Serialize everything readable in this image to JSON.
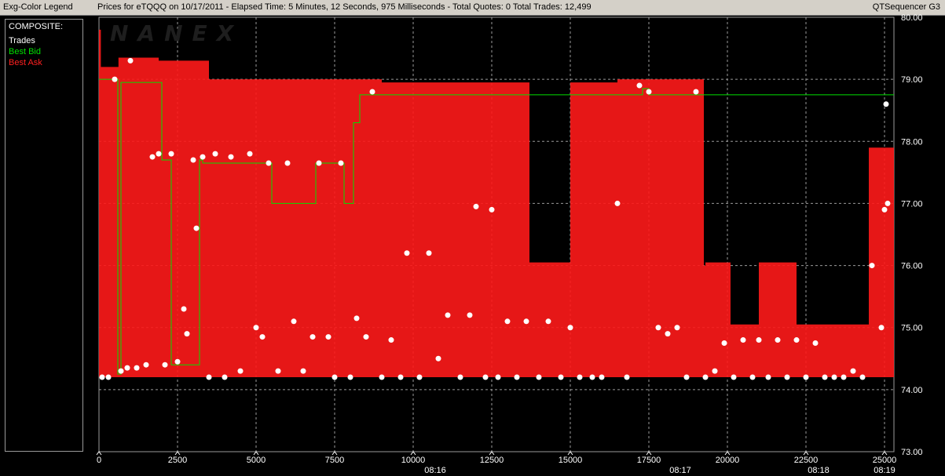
{
  "header": {
    "legend_title": "Exg-Color Legend",
    "chart_title": "Prices for  eTQQQ  on  10/17/2011  -  Elapsed Time: 5 Minutes, 12 Seconds, 975 Milliseconds  -  Total Quotes: 0  Total Trades: 12,499",
    "app_name": "QTSequencer G3"
  },
  "legend": {
    "group": "COMPOSITE:",
    "items": [
      {
        "label": "Trades",
        "color": "#ffffff"
      },
      {
        "label": "Best Bid",
        "color": "#00e000"
      },
      {
        "label": "Best Ask",
        "color": "#ff1a1a"
      }
    ]
  },
  "watermark": "NANEX",
  "chart_data": {
    "type": "scatter",
    "title": "Prices for  eTQQQ  on  10/17/2011",
    "xlim": [
      0,
      25300
    ],
    "ylim": [
      73.0,
      80.0
    ],
    "x_ticks": [
      0,
      2500,
      5000,
      7500,
      10000,
      12500,
      15000,
      17500,
      20000,
      22500,
      25000
    ],
    "y_ticks": [
      73.0,
      74.0,
      75.0,
      76.0,
      77.0,
      78.0,
      79.0,
      80.0
    ],
    "time_ticks": [
      {
        "x": 10700,
        "label": "08:16"
      },
      {
        "x": 18500,
        "label": "08:17"
      },
      {
        "x": 22900,
        "label": "08:18"
      },
      {
        "x": 25000,
        "label": "08:19"
      }
    ],
    "grid": true,
    "colors": {
      "trades": "#ffffff",
      "bid": "#00e000",
      "ask": "#ff1a1a",
      "grid": "#9a9a9a"
    },
    "series": [
      {
        "name": "Best Ask",
        "type": "step",
        "points": [
          [
            0,
            79.8
          ],
          [
            60,
            79.2
          ],
          [
            620,
            79.35
          ],
          [
            1900,
            79.3
          ],
          [
            3500,
            79.0
          ],
          [
            9000,
            78.95
          ],
          [
            13600,
            78.95
          ],
          [
            13700,
            76.05
          ],
          [
            15000,
            78.95
          ],
          [
            16500,
            79.0
          ],
          [
            19200,
            79.0
          ],
          [
            19250,
            76.0
          ],
          [
            19300,
            76.05
          ],
          [
            20100,
            75.05
          ],
          [
            21000,
            76.05
          ],
          [
            22000,
            76.05
          ],
          [
            22200,
            75.05
          ],
          [
            23000,
            75.05
          ],
          [
            24500,
            77.9
          ],
          [
            25000,
            77.9
          ],
          [
            25300,
            78.8
          ]
        ]
      },
      {
        "name": "Best Bid",
        "type": "step",
        "points": [
          [
            0,
            79.0
          ],
          [
            600,
            74.25
          ],
          [
            700,
            78.95
          ],
          [
            2000,
            77.7
          ],
          [
            2300,
            74.4
          ],
          [
            3200,
            77.7
          ],
          [
            3300,
            77.65
          ],
          [
            5100,
            77.65
          ],
          [
            5500,
            77.0
          ],
          [
            6600,
            77.0
          ],
          [
            6900,
            77.65
          ],
          [
            7800,
            77.0
          ],
          [
            8100,
            78.3
          ],
          [
            8300,
            78.75
          ],
          [
            17300,
            78.85
          ],
          [
            17500,
            78.75
          ],
          [
            25300,
            78.75
          ]
        ]
      },
      {
        "name": "Trades",
        "type": "scatter",
        "points": [
          [
            100,
            74.2
          ],
          [
            300,
            74.2
          ],
          [
            500,
            79.0
          ],
          [
            700,
            74.3
          ],
          [
            900,
            74.35
          ],
          [
            1000,
            79.3
          ],
          [
            1200,
            74.35
          ],
          [
            1500,
            74.4
          ],
          [
            1700,
            77.75
          ],
          [
            1900,
            77.8
          ],
          [
            2100,
            74.4
          ],
          [
            2300,
            77.8
          ],
          [
            2500,
            74.45
          ],
          [
            2700,
            75.3
          ],
          [
            2800,
            74.9
          ],
          [
            3000,
            77.7
          ],
          [
            3100,
            76.6
          ],
          [
            3300,
            77.75
          ],
          [
            3500,
            74.2
          ],
          [
            3700,
            77.8
          ],
          [
            4000,
            74.2
          ],
          [
            4200,
            77.75
          ],
          [
            4500,
            74.3
          ],
          [
            4800,
            77.8
          ],
          [
            5000,
            75.0
          ],
          [
            5200,
            74.85
          ],
          [
            5400,
            77.65
          ],
          [
            5700,
            74.3
          ],
          [
            6000,
            77.65
          ],
          [
            6200,
            75.1
          ],
          [
            6500,
            74.3
          ],
          [
            6800,
            74.85
          ],
          [
            7000,
            77.65
          ],
          [
            7300,
            74.85
          ],
          [
            7500,
            74.2
          ],
          [
            7700,
            77.65
          ],
          [
            8000,
            74.2
          ],
          [
            8200,
            75.15
          ],
          [
            8500,
            74.85
          ],
          [
            8700,
            78.8
          ],
          [
            9000,
            74.2
          ],
          [
            9300,
            74.8
          ],
          [
            9600,
            74.2
          ],
          [
            9800,
            76.2
          ],
          [
            10200,
            74.2
          ],
          [
            10500,
            76.2
          ],
          [
            10800,
            74.5
          ],
          [
            11100,
            75.2
          ],
          [
            11500,
            74.2
          ],
          [
            11800,
            75.2
          ],
          [
            12000,
            76.95
          ],
          [
            12300,
            74.2
          ],
          [
            12500,
            76.9
          ],
          [
            12700,
            74.2
          ],
          [
            13000,
            75.1
          ],
          [
            13300,
            74.2
          ],
          [
            13600,
            75.1
          ],
          [
            14000,
            74.2
          ],
          [
            14300,
            75.1
          ],
          [
            14700,
            74.2
          ],
          [
            15000,
            75.0
          ],
          [
            15300,
            74.2
          ],
          [
            15700,
            74.2
          ],
          [
            16000,
            74.2
          ],
          [
            16500,
            77.0
          ],
          [
            16800,
            74.2
          ],
          [
            17200,
            78.9
          ],
          [
            17500,
            78.8
          ],
          [
            17800,
            75.0
          ],
          [
            18100,
            74.9
          ],
          [
            18400,
            75.0
          ],
          [
            18700,
            74.2
          ],
          [
            19000,
            78.8
          ],
          [
            19300,
            74.2
          ],
          [
            19600,
            74.3
          ],
          [
            19900,
            74.75
          ],
          [
            20200,
            74.2
          ],
          [
            20500,
            74.8
          ],
          [
            20800,
            74.2
          ],
          [
            21000,
            74.8
          ],
          [
            21300,
            74.2
          ],
          [
            21600,
            74.8
          ],
          [
            21900,
            74.2
          ],
          [
            22200,
            74.8
          ],
          [
            22500,
            74.2
          ],
          [
            22800,
            74.75
          ],
          [
            23100,
            74.2
          ],
          [
            23400,
            74.2
          ],
          [
            23700,
            74.2
          ],
          [
            24000,
            74.3
          ],
          [
            24300,
            74.2
          ],
          [
            24600,
            76.0
          ],
          [
            24900,
            75.0
          ],
          [
            25000,
            76.9
          ],
          [
            25050,
            78.6
          ],
          [
            25100,
            77.0
          ]
        ]
      }
    ]
  }
}
